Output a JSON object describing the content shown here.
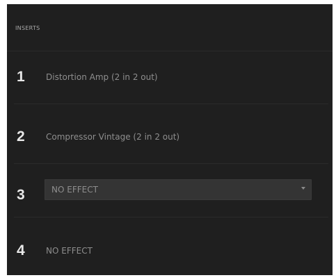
{
  "header": {
    "title": "INSERTS"
  },
  "slots": [
    {
      "number": "1",
      "effect": "Distortion Amp (2 in 2 out)"
    },
    {
      "number": "2",
      "effect": "Compressor Vintage (2 in 2 out)"
    },
    {
      "number": "3",
      "effect": "NO EFFECT"
    },
    {
      "number": "4",
      "effect": "NO EFFECT"
    }
  ],
  "icons": {
    "dropdown": "chevron-down-icon"
  },
  "colors": {
    "panel_bg": "#1f1f1f",
    "number_text": "#e8e8e8",
    "label_text": "#8e8e8e",
    "select_bg": "#343434"
  }
}
